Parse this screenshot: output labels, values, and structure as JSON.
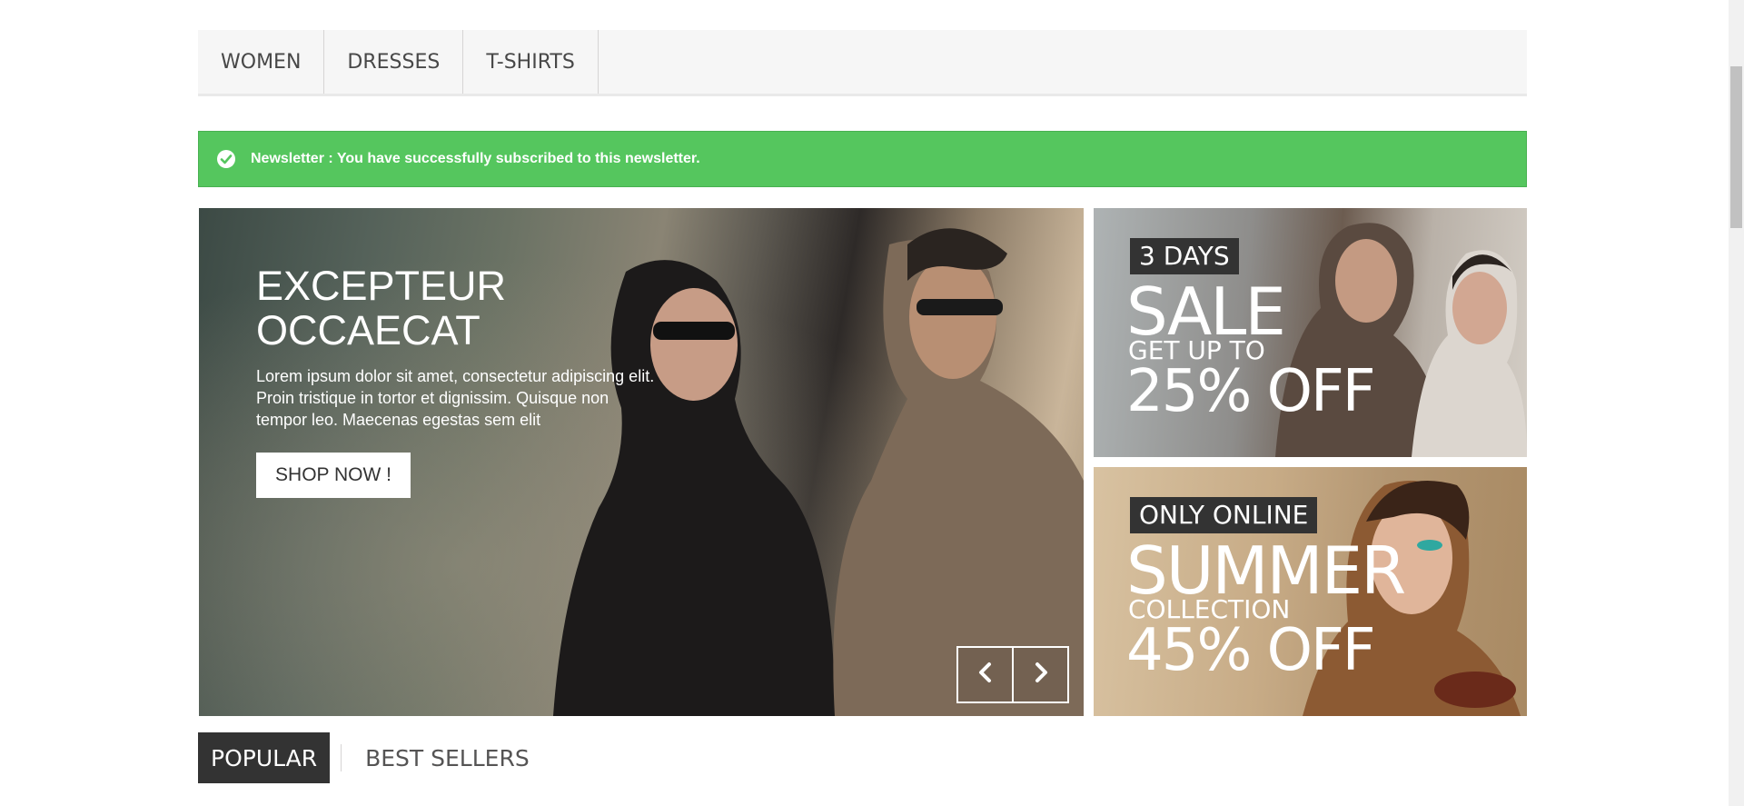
{
  "menu": {
    "items": [
      {
        "label": "WOMEN"
      },
      {
        "label": "DRESSES"
      },
      {
        "label": "T-SHIRTS"
      }
    ]
  },
  "alert": {
    "icon": "check-circle-icon",
    "text": "Newsletter : You have successfully subscribed to this newsletter.",
    "color": "#55c65e"
  },
  "slider": {
    "title": "EXCEPTEUR OCCAECAT",
    "description": "Lorem ipsum dolor sit amet, consectetur adipiscing elit. Proin tristique in tortor et dignissim. Quisque non tempor leo. Maecenas egestas sem elit",
    "button_label": "SHOP NOW !",
    "prev_icon": "chevron-left-icon",
    "next_icon": "chevron-right-icon"
  },
  "banners": [
    {
      "tag": "3 DAYS",
      "big": "SALE",
      "mid": "GET UP TO",
      "off": "25% OFF"
    },
    {
      "tag": "ONLY ONLINE",
      "big": "SUMMER",
      "mid": "COLLECTION",
      "off": "45% OFF"
    }
  ],
  "tabs": [
    {
      "label": "POPULAR",
      "active": true
    },
    {
      "label": "BEST SELLERS",
      "active": false
    }
  ]
}
